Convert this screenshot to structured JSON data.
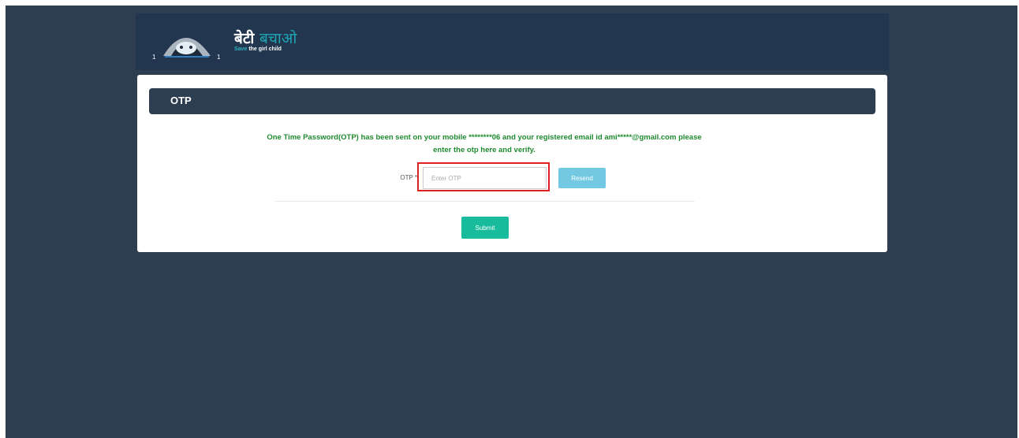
{
  "header": {
    "logo": {
      "hindi_part1": "बेटी",
      "hindi_part2": "बचाओ",
      "tagline_part1": "Save",
      "tagline_part2": "the girl child"
    }
  },
  "panel": {
    "title": "OTP"
  },
  "form": {
    "message": "One Time Password(OTP) has been sent on your mobile ********06 and your registered email id ami*****@gmail.com please enter the otp here and verify.",
    "otp_label": "OTP *",
    "otp_placeholder": "Enter OTP",
    "otp_value": "",
    "resend_label": "Resend",
    "submit_label": "Submit"
  },
  "colors": {
    "page_background": "#2c3e50",
    "header_background": "#22364f",
    "message_text": "#1e8a2e",
    "resend_button": "#5bc0de",
    "submit_button": "#18bc9c",
    "highlight": "#e02020"
  }
}
